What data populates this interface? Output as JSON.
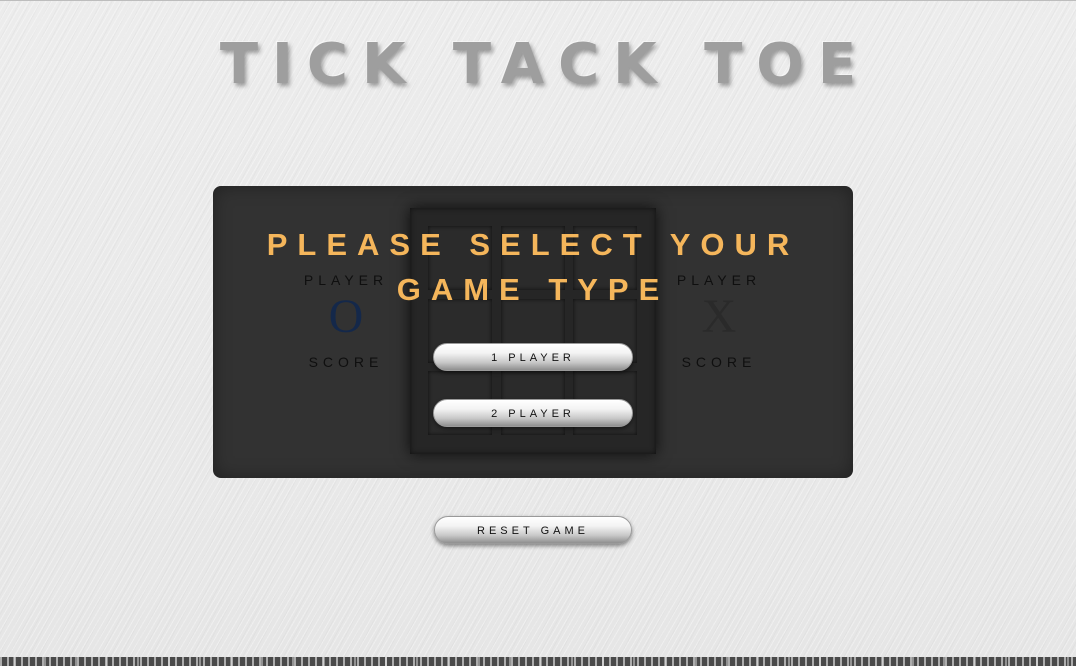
{
  "game": {
    "title": "TICK TACK TOE"
  },
  "players": {
    "left": {
      "label": "PLAYER",
      "symbol": "O",
      "score_label": "SCORE",
      "color": "#14284a"
    },
    "right": {
      "label": "PLAYER",
      "symbol": "X",
      "score_label": "SCORE",
      "color": "#2a2a2a"
    }
  },
  "overlay": {
    "title_line1": "PLEASE SELECT YOUR",
    "title_line2": "GAME TYPE",
    "title_color": "#f5b65b",
    "one_player_label": "1 PLAYER",
    "two_player_label": "2 PLAYER"
  },
  "board": {
    "cells": [
      "",
      "",
      "",
      "",
      "",
      "",
      "",
      "",
      ""
    ]
  },
  "controls": {
    "reset_label": "RESET GAME"
  }
}
